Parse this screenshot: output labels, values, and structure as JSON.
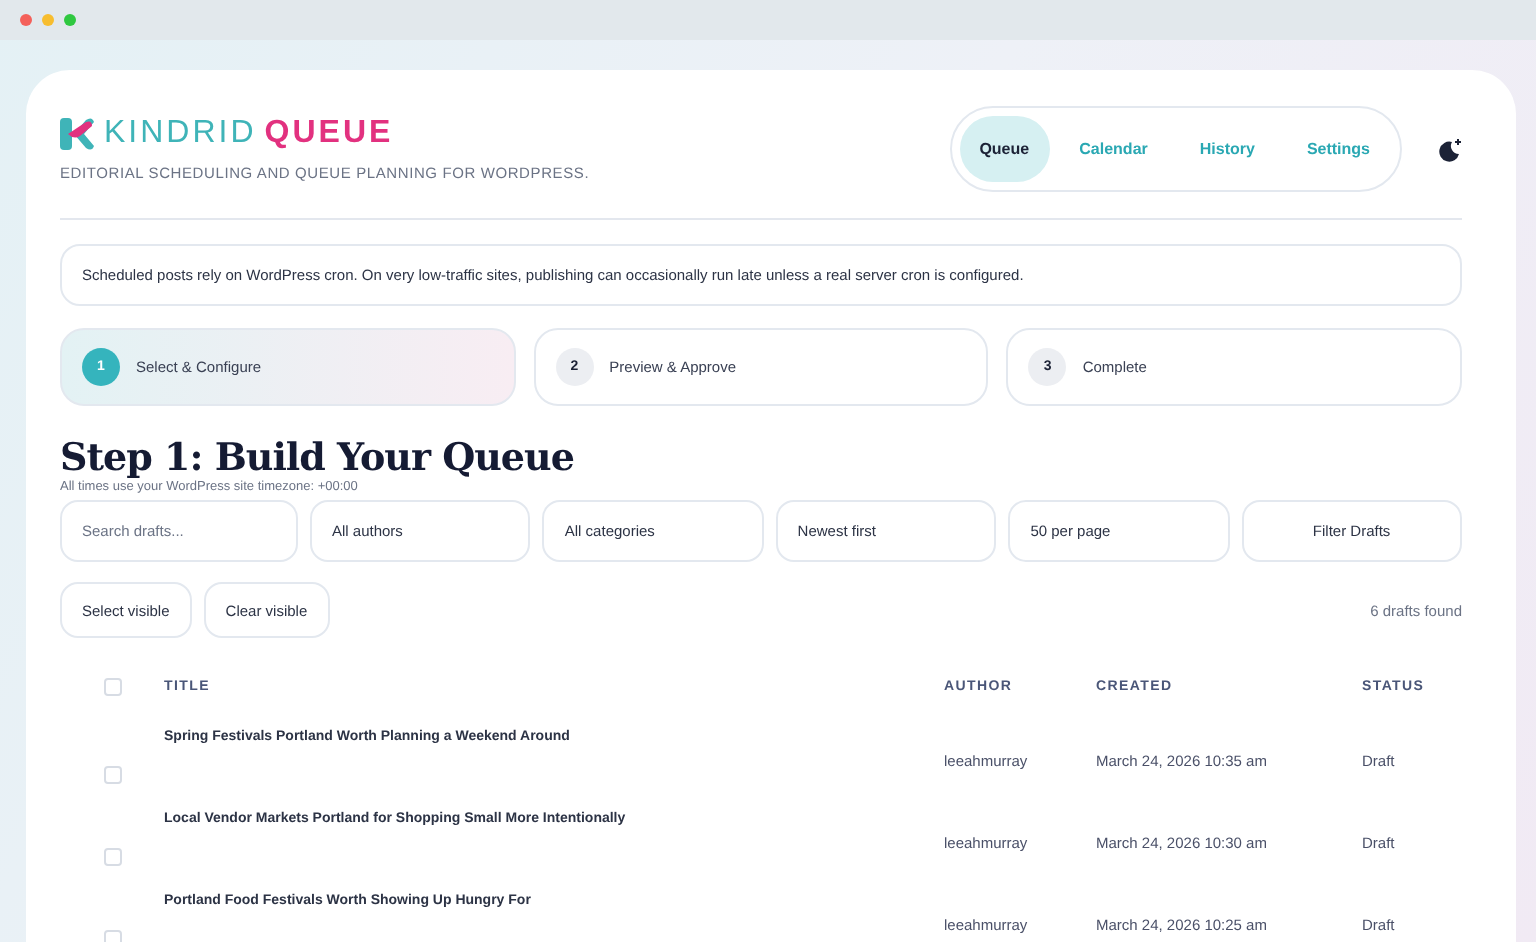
{
  "brand": {
    "name_part_1": "KINDRID",
    "name_part_2": "QUEUE",
    "tagline": "EDITORIAL SCHEDULING AND QUEUE PLANNING FOR WORDPRESS."
  },
  "nav": [
    {
      "label": "Queue",
      "selected": true
    },
    {
      "label": "Calendar",
      "selected": false
    },
    {
      "label": "History",
      "selected": false
    },
    {
      "label": "Settings",
      "selected": false
    }
  ],
  "notice": "Scheduled posts rely on WordPress cron. On very low-traffic sites, publishing can occasionally run late unless a real server cron is configured.",
  "steps": [
    {
      "number": "1",
      "label": "Select & Configure",
      "selected": true
    },
    {
      "number": "2",
      "label": "Preview & Approve",
      "selected": false
    },
    {
      "number": "3",
      "label": "Complete",
      "selected": false
    }
  ],
  "heading": "Step 1: Build Your Queue",
  "timezone_note": "All times use your WordPress site timezone: +00:00",
  "filters": [
    {
      "kind": "input",
      "placeholder": "Search drafts..."
    },
    {
      "kind": "select",
      "value": "All authors"
    },
    {
      "kind": "select",
      "value": "All categories"
    },
    {
      "kind": "select",
      "value": "Newest first"
    },
    {
      "kind": "select",
      "value": "50 per page"
    },
    {
      "kind": "button",
      "label": "Filter Drafts"
    }
  ],
  "actions": [
    "Select visible",
    "Clear visible"
  ],
  "result_count": "6 drafts found",
  "table": {
    "select_all_checked": false,
    "columns": [
      "TITLE",
      "AUTHOR",
      "CREATED",
      "STATUS"
    ],
    "rows": [
      {
        "checked": false,
        "title": "Spring Festivals Portland Worth Planning a Weekend Around",
        "author": "leeahmurray",
        "created": "March 24, 2026 10:35 am",
        "status": "Draft"
      },
      {
        "checked": false,
        "title": "Local Vendor Markets Portland for Shopping Small More Intentionally",
        "author": "leeahmurray",
        "created": "March 24, 2026 10:30 am",
        "status": "Draft"
      },
      {
        "checked": false,
        "title": "Portland Food Festivals Worth Showing Up Hungry For",
        "author": "leeahmurray",
        "created": "March 24, 2026 10:25 am",
        "status": "Draft"
      }
    ]
  }
}
